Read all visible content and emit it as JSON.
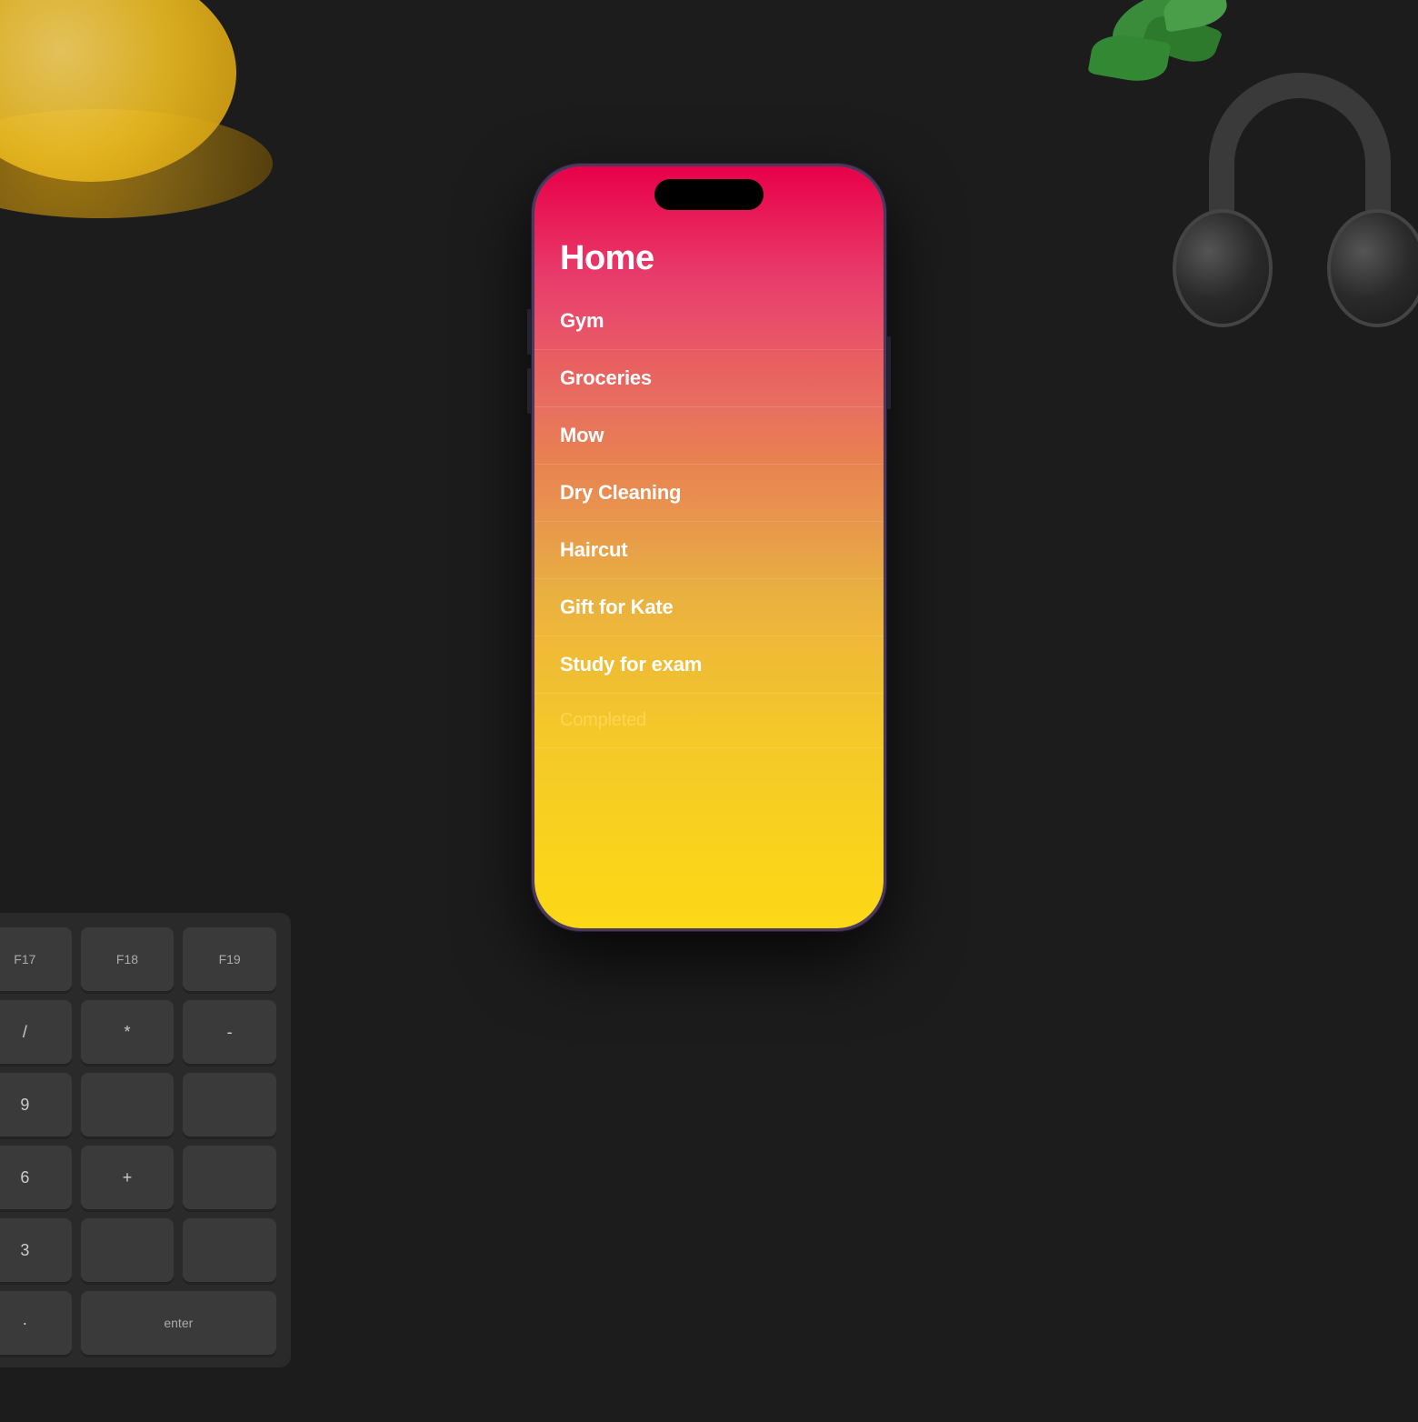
{
  "desktop": {
    "background_color": "#1c1c1c"
  },
  "keyboard": {
    "keys": [
      {
        "label": "F17",
        "wide": false
      },
      {
        "label": "F18",
        "wide": false
      },
      {
        "label": "F19",
        "wide": false
      },
      {
        "label": "/",
        "wide": false
      },
      {
        "label": "*",
        "wide": false
      },
      {
        "label": "-",
        "wide": false
      },
      {
        "label": "9",
        "wide": false
      },
      {
        "label": "",
        "wide": false
      },
      {
        "label": "",
        "wide": false
      },
      {
        "label": "6",
        "wide": false
      },
      {
        "label": "+",
        "wide": false
      },
      {
        "label": "",
        "wide": false
      },
      {
        "label": "3",
        "wide": false
      },
      {
        "label": "",
        "wide": false
      },
      {
        "label": "",
        "wide": false
      },
      {
        "label": "·",
        "wide": false
      },
      {
        "label": "enter",
        "wide": true
      }
    ]
  },
  "phone": {
    "app": {
      "title": "Home",
      "items": [
        {
          "id": 1,
          "text": "Gym",
          "completed": false
        },
        {
          "id": 2,
          "text": "Groceries",
          "completed": false
        },
        {
          "id": 3,
          "text": "Mow",
          "completed": false
        },
        {
          "id": 4,
          "text": "Dry Cleaning",
          "completed": false
        },
        {
          "id": 5,
          "text": "Haircut",
          "completed": false
        },
        {
          "id": 6,
          "text": "Gift for Kate",
          "completed": false
        },
        {
          "id": 7,
          "text": "Study for exam",
          "completed": false
        }
      ],
      "completed_label": "Completed"
    }
  }
}
